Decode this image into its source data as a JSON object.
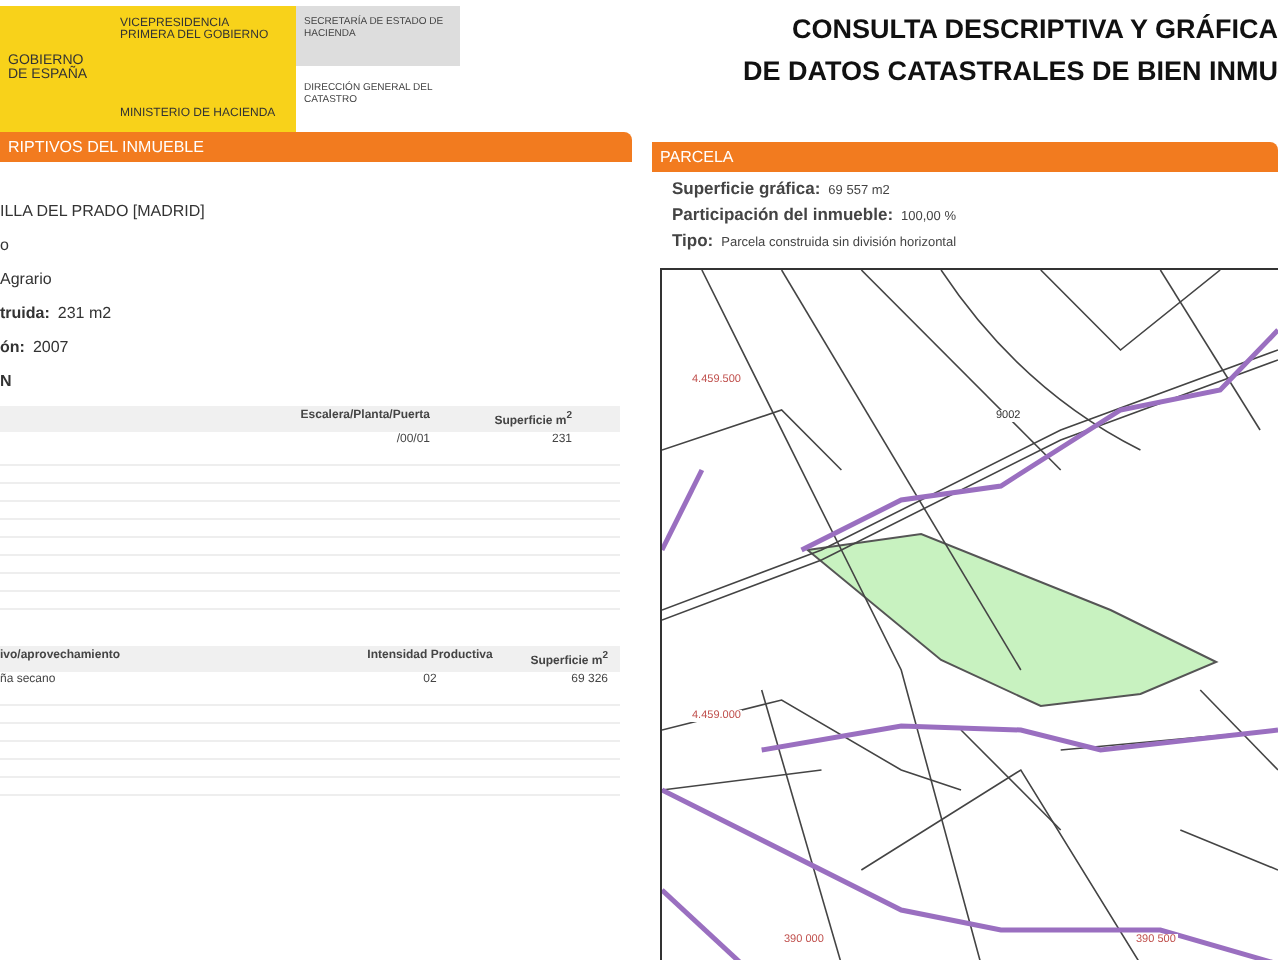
{
  "header": {
    "logo_text": [
      "GOBIERNO",
      "DE ESPAÑA"
    ],
    "ministry_top": "VICEPRESIDENCIA PRIMERA DEL GOBIERNO",
    "ministry_bottom": "MINISTERIO DE HACIENDA",
    "secretary": "SECRETARÍA DE ESTADO DE HACIENDA",
    "direction": "DIRECCIÓN GENERAL DEL CATASTRO",
    "title": [
      "CONSULTA DESCRIPTIVA Y GRÁFICA",
      "DE DATOS CATASTRALES DE BIEN INMU"
    ]
  },
  "left": {
    "section_title": "RIPTIVOS DEL INMUEBLE",
    "lines": [
      {
        "value": "ILLA DEL PRADO [MADRID]"
      },
      {
        "value": "o"
      },
      {
        "value": "Agrario"
      },
      {
        "label": "truida:",
        "value": "231 m2"
      },
      {
        "label": "ón:",
        "value": "2007"
      },
      {
        "label": "N"
      }
    ],
    "table_1": {
      "columns": [
        "Escalera/Planta/Puerta",
        "Superficie m$^{2}$"
      ],
      "rows": [
        [
          "/00/01",
          "231"
        ]
      ]
    },
    "table_2": {
      "columns": [
        "ivo/aprovechamiento",
        "Intensidad Productiva",
        "Superficie m$^{2}$"
      ],
      "rows": [
        [
          "ña secano",
          "02",
          "69 326"
        ]
      ]
    }
  },
  "parcel": {
    "section_title": "PARCELA",
    "fields": [
      {
        "label": "Superficie gráfica:",
        "value": "69 557 m2"
      },
      {
        "label": "Participación del inmueble:",
        "value": "100,00 %"
      },
      {
        "label": "Tipo:",
        "value": "Parcela construida sin división horizontal"
      }
    ],
    "map_labels": [
      {
        "text": "4.459.500",
        "kind": "coord"
      },
      {
        "text": "9002",
        "kind": "parcel"
      },
      {
        "text": "4.459.000",
        "kind": "coord"
      },
      {
        "text": "390 000",
        "kind": "coord"
      },
      {
        "text": "390 500",
        "kind": "coord"
      }
    ]
  }
}
